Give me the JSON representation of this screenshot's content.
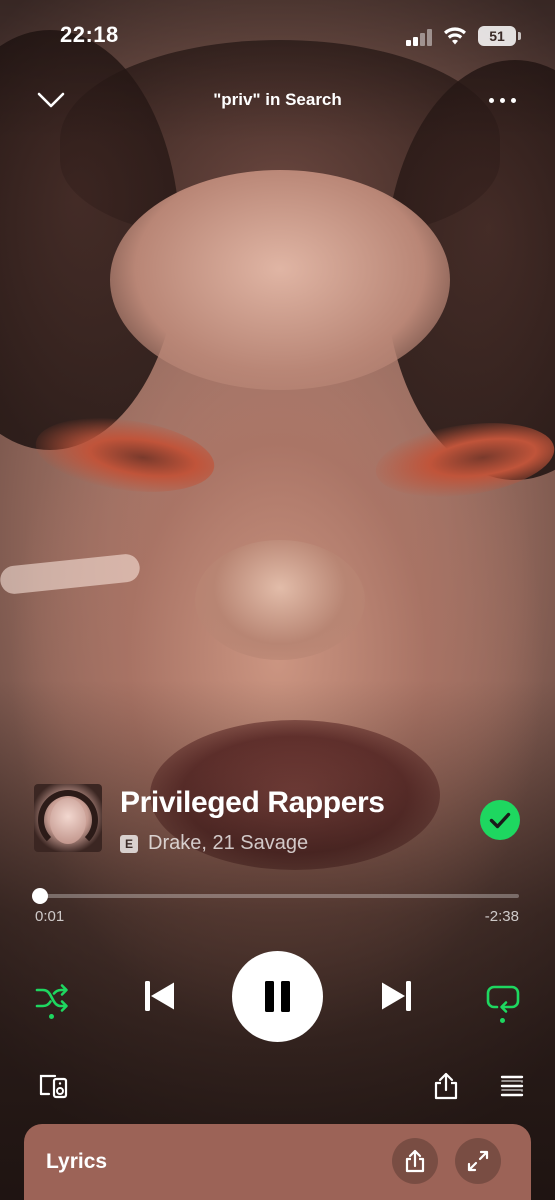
{
  "status_bar": {
    "time": "22:18",
    "battery": "51"
  },
  "header": {
    "context_label": "\"priv\" in Search"
  },
  "track": {
    "title": "Privileged Rappers",
    "artists": "Drake, 21 Savage",
    "explicit_badge": "E",
    "liked": true
  },
  "progress": {
    "elapsed": "0:01",
    "remaining": "-2:38",
    "fraction": 0.01
  },
  "controls": {
    "shuffle_on": true,
    "repeat_on": true,
    "playing": true
  },
  "lyrics": {
    "title": "Lyrics"
  },
  "colors": {
    "accent_green": "#1ed760",
    "lyrics_card": "#9c6357"
  },
  "icons": [
    "chevron-down-icon",
    "more-icon",
    "shuffle-icon",
    "previous-icon",
    "pause-icon",
    "next-icon",
    "repeat-icon",
    "connect-device-icon",
    "share-icon",
    "queue-icon",
    "expand-icon",
    "check-icon"
  ]
}
